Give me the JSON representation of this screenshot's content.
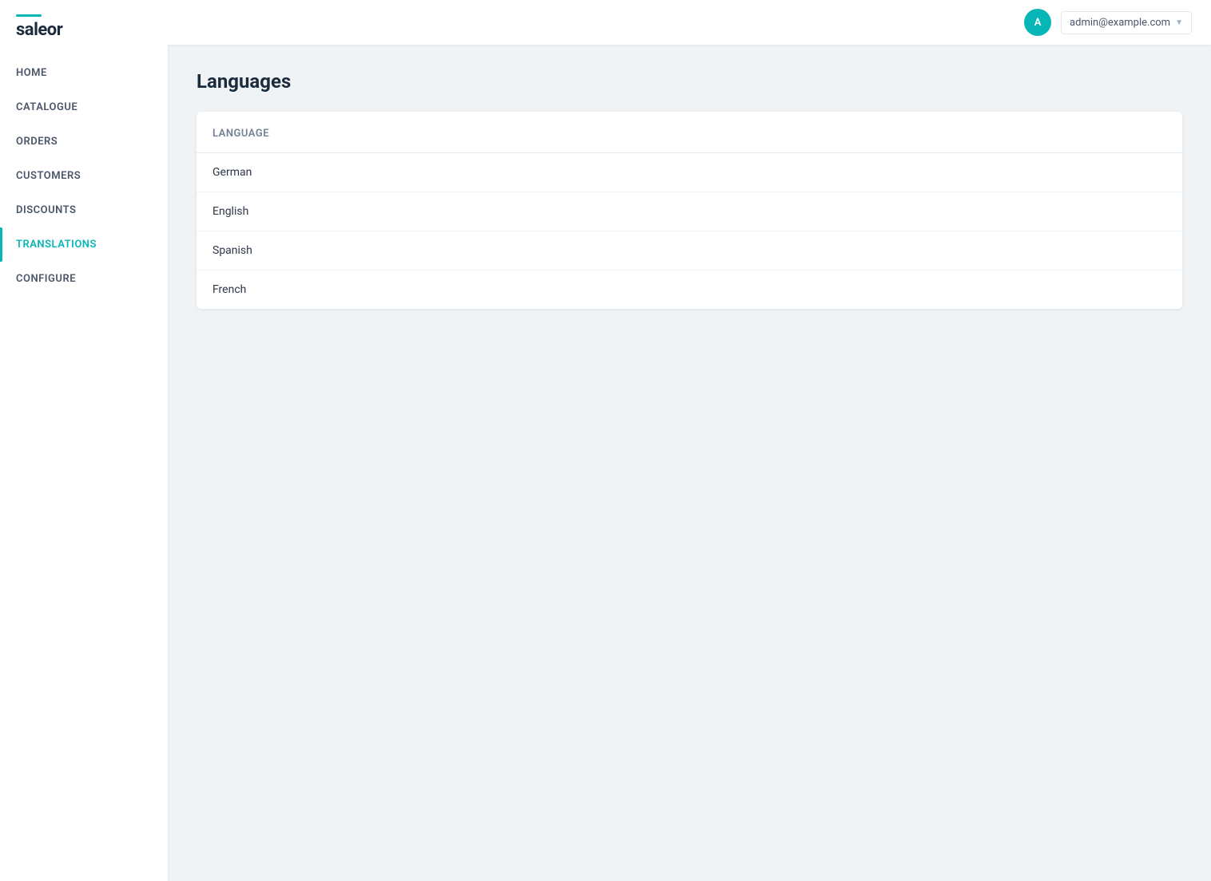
{
  "brand": {
    "name": "saleor",
    "logo_bar_color": "#06b6b6"
  },
  "sidebar": {
    "items": [
      {
        "id": "home",
        "label": "HOME",
        "active": false
      },
      {
        "id": "catalogue",
        "label": "CATALOGUE",
        "active": false
      },
      {
        "id": "orders",
        "label": "ORDERS",
        "active": false
      },
      {
        "id": "customers",
        "label": "CUSTOMERS",
        "active": false
      },
      {
        "id": "discounts",
        "label": "DISCOUNTS",
        "active": false
      },
      {
        "id": "translations",
        "label": "TRANSLATIONS",
        "active": true
      },
      {
        "id": "configure",
        "label": "CONFIGURE",
        "active": false
      }
    ]
  },
  "topbar": {
    "avatar_initials": "A",
    "user_email": "admin@example.com",
    "dropdown_arrow": "▼"
  },
  "page": {
    "title": "Languages",
    "table_header": "Language",
    "languages": [
      {
        "name": "German"
      },
      {
        "name": "English"
      },
      {
        "name": "Spanish"
      },
      {
        "name": "French"
      }
    ]
  }
}
